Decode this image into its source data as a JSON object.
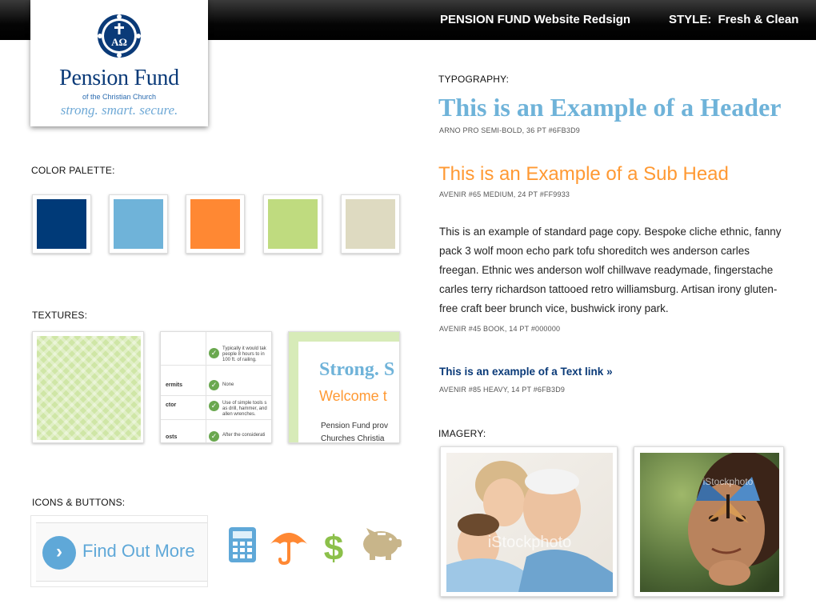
{
  "header": {
    "project": "PENSION FUND Website Redsign",
    "style_label": "STYLE:",
    "style_value": "Fresh & Clean"
  },
  "logo": {
    "seal_text": "ΑΩ",
    "name": "Pension Fund",
    "subtitle": "of the Christian Church",
    "tagline": "strong. smart. secure."
  },
  "sections": {
    "color_palette": "COLOR PALETTE:",
    "textures": "TEXTURES:",
    "icons_buttons": "ICONS & BUTTONS:",
    "typography": "TYPOGRAPHY:",
    "imagery": "IMAGERY:"
  },
  "palette": [
    {
      "name": "navy",
      "color": "#003A78"
    },
    {
      "name": "light-blue",
      "color": "#6FB3D9"
    },
    {
      "name": "orange",
      "color": "#FF8833"
    },
    {
      "name": "green",
      "color": "#BFDB7F"
    },
    {
      "name": "beige",
      "color": "#DEDAC1"
    }
  ],
  "textures": {
    "table": {
      "rows": [
        {
          "label": "",
          "text": "Typically it would tak people 8 hours to in 100 ft. of railing."
        },
        {
          "label": "ermits",
          "text": "None"
        },
        {
          "label": "ctor",
          "text": "Use of simple tools s as drill, hammer, and allen wrenches."
        },
        {
          "label": "osts",
          "text": "After the considerati"
        }
      ]
    },
    "web": {
      "heading": "Strong. S",
      "subhead": "Welcome t",
      "line1": "Pension Fund prov",
      "line2": "Churches Christia"
    }
  },
  "button": {
    "label": "Find Out More",
    "arrow": "›"
  },
  "icons": [
    "calculator-icon",
    "umbrella-icon",
    "dollar-icon",
    "piggy-bank-icon"
  ],
  "icon_colors": {
    "calculator": "#5FA8D8",
    "umbrella": "#FF8833",
    "dollar": "#8CC04A",
    "piggy": "#C8B58A"
  },
  "typography": {
    "header_text": "This is an Example of a Header",
    "header_spec": "ARNO PRO SEMI-BOLD, 36 PT  #6FB3D9",
    "subhead_text": "This is an Example of a Sub Head",
    "subhead_spec": "AVENIR #65 MEDIUM, 24 PT  #FF9933",
    "body_text": "This is an example of standard page copy. Bespoke cliche ethnic, fanny pack 3 wolf moon echo park tofu shoreditch wes anderson carles freegan. Ethnic wes anderson wolf chillwave readymade, fingerstache carles terry richardson tattooed retro williamsburg. Artisan irony gluten-free craft beer brunch vice, bushwick irony park.",
    "body_spec": "AVENIR #45 BOOK, 14 PT  #000000",
    "link_text": "This is an example of a Text link »",
    "link_spec": "AVENIR #85 HEAVY, 14 PT  #6FB3D9"
  },
  "imagery": {
    "watermark": "iStockphoto"
  }
}
